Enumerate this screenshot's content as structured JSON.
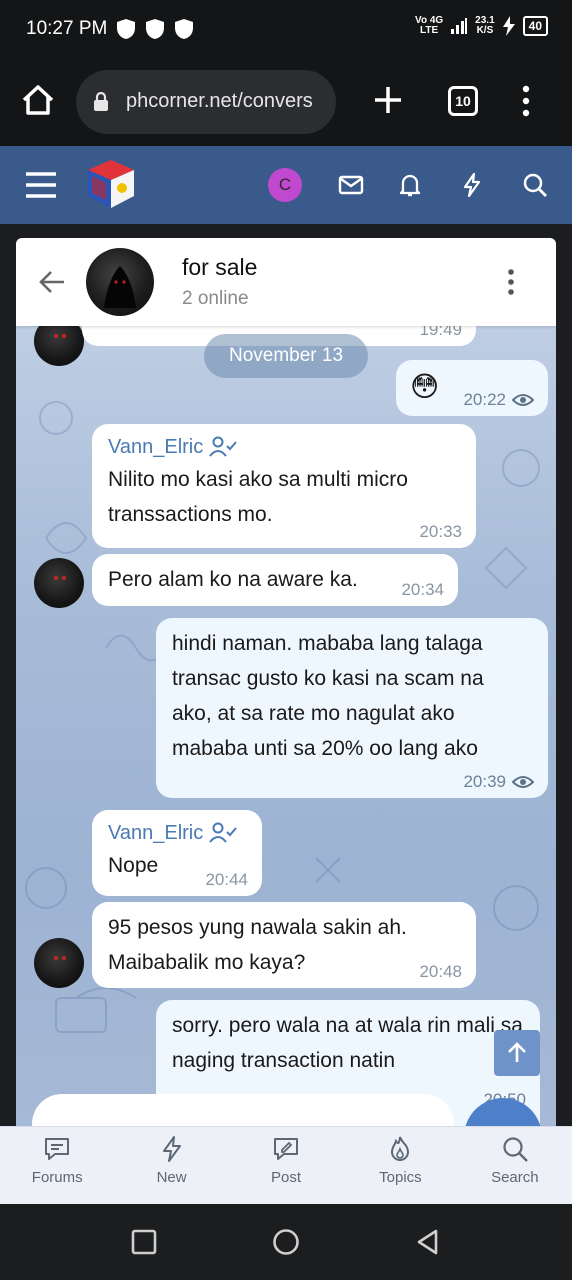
{
  "statusbar": {
    "time": "10:27 PM",
    "network_line1": "Vo 4G",
    "network_line2": "LTE",
    "speed": "23.1",
    "speed_unit": "K/S",
    "battery": "40"
  },
  "browser": {
    "url": "phcorner.net/convers",
    "tab_count": "10"
  },
  "header": {
    "avatar_letter": "C"
  },
  "chat": {
    "title": "for sale",
    "subtitle": "2 online",
    "date_divider": "November 13",
    "partial_top_time": "19:49",
    "messages": [
      {
        "id": "m1",
        "direction": "out",
        "text": "😳",
        "time": "20:22",
        "seen": true
      },
      {
        "id": "m2",
        "direction": "in",
        "sender": "Vann_Elric",
        "text": "Nilito mo kasi ako sa multi micro transsactions mo.",
        "time": "20:33"
      },
      {
        "id": "m3",
        "direction": "in",
        "text": "Pero alam ko na aware ka.",
        "time": "20:34"
      },
      {
        "id": "m4",
        "direction": "out",
        "text": "hindi naman. mababa lang talaga transac gusto ko kasi na scam na ako, at sa rate mo nagulat ako mababa unti sa 20% oo lang ako",
        "time": "20:39",
        "seen": true
      },
      {
        "id": "m5",
        "direction": "in",
        "sender": "Vann_Elric",
        "text": "Nope",
        "time": "20:44"
      },
      {
        "id": "m6",
        "direction": "in",
        "text": "95 pesos yung nawala sakin ah. Maibabalik mo kaya?",
        "time": "20:48"
      },
      {
        "id": "m7",
        "direction": "out",
        "text": "sorry. pero wala na at wala rin mali sa naging transaction natin",
        "time": "20:50"
      }
    ]
  },
  "bottom_nav": [
    {
      "label": "Forums",
      "icon": "forums-icon"
    },
    {
      "label": "New",
      "icon": "lightning-icon"
    },
    {
      "label": "Post",
      "icon": "post-icon"
    },
    {
      "label": "Topics",
      "icon": "fire-icon"
    },
    {
      "label": "Search",
      "icon": "search-icon"
    }
  ]
}
